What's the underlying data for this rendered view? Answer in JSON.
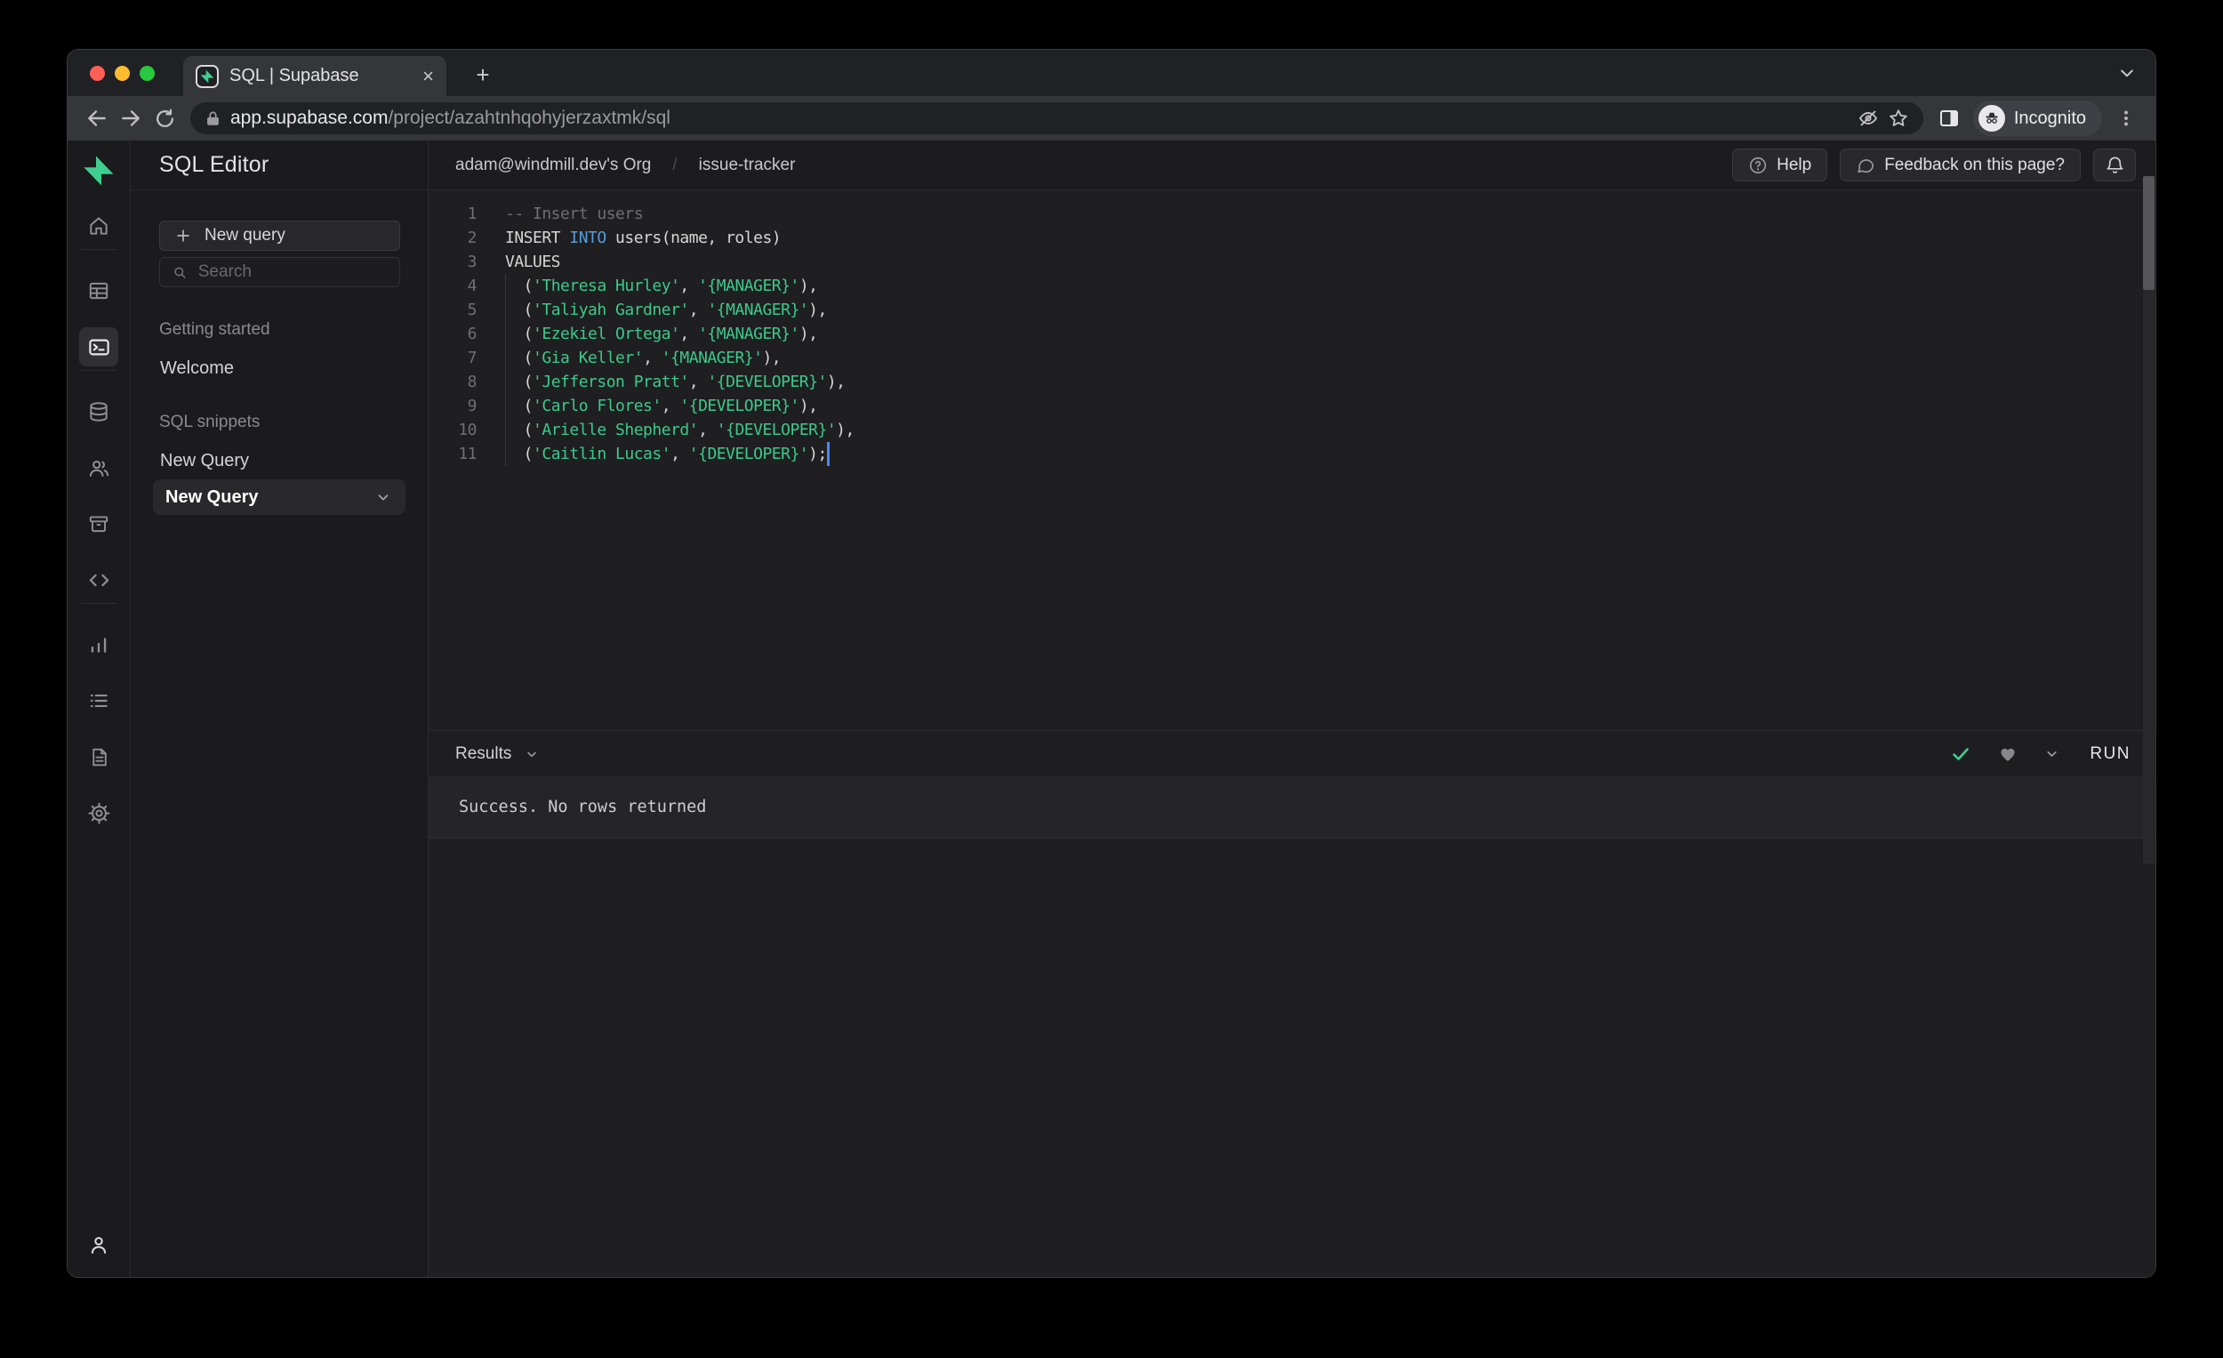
{
  "browser": {
    "tab_title": "SQL | Supabase",
    "new_tab_glyph": "+",
    "close_glyph": "×",
    "url_host": "app.supabase.com",
    "url_path": "/project/azahtnhqohyjerzaxtmk/sql",
    "incognito_label": "Incognito"
  },
  "sidebar": {
    "title": "SQL Editor",
    "new_query_button": "New query",
    "search_placeholder": "Search",
    "sections": [
      {
        "heading": "Getting started",
        "items": [
          "Welcome"
        ]
      },
      {
        "heading": "SQL snippets",
        "items": [
          "New Query"
        ]
      }
    ],
    "selected_snippet": "New Query"
  },
  "header": {
    "breadcrumb_org": "adam@windmill.dev's Org",
    "breadcrumb_sep": "/",
    "breadcrumb_project": "issue-tracker",
    "help_label": "Help",
    "feedback_label": "Feedback on this page?"
  },
  "editor": {
    "lines": [
      {
        "num": "1",
        "segments": [
          {
            "text": "-- Insert users",
            "style": "comment"
          }
        ]
      },
      {
        "num": "2",
        "segments": [
          {
            "text": "INSERT ",
            "style": "plain"
          },
          {
            "text": "INTO",
            "style": "keyword"
          },
          {
            "text": " users(name, roles)",
            "style": "plain"
          }
        ]
      },
      {
        "num": "3",
        "segments": [
          {
            "text": "VALUES",
            "style": "plain"
          }
        ]
      },
      {
        "num": "4",
        "segments": [
          {
            "text": "  (",
            "style": "plain"
          },
          {
            "text": "'Theresa Hurley'",
            "style": "string"
          },
          {
            "text": ", ",
            "style": "plain"
          },
          {
            "text": "'{MANAGER}'",
            "style": "string"
          },
          {
            "text": "),",
            "style": "plain"
          }
        ]
      },
      {
        "num": "5",
        "segments": [
          {
            "text": "  (",
            "style": "plain"
          },
          {
            "text": "'Taliyah Gardner'",
            "style": "string"
          },
          {
            "text": ", ",
            "style": "plain"
          },
          {
            "text": "'{MANAGER}'",
            "style": "string"
          },
          {
            "text": "),",
            "style": "plain"
          }
        ]
      },
      {
        "num": "6",
        "segments": [
          {
            "text": "  (",
            "style": "plain"
          },
          {
            "text": "'Ezekiel Ortega'",
            "style": "string"
          },
          {
            "text": ", ",
            "style": "plain"
          },
          {
            "text": "'{MANAGER}'",
            "style": "string"
          },
          {
            "text": "),",
            "style": "plain"
          }
        ]
      },
      {
        "num": "7",
        "segments": [
          {
            "text": "  (",
            "style": "plain"
          },
          {
            "text": "'Gia Keller'",
            "style": "string"
          },
          {
            "text": ", ",
            "style": "plain"
          },
          {
            "text": "'{MANAGER}'",
            "style": "string"
          },
          {
            "text": "),",
            "style": "plain"
          }
        ]
      },
      {
        "num": "8",
        "segments": [
          {
            "text": "  (",
            "style": "plain"
          },
          {
            "text": "'Jefferson Pratt'",
            "style": "string"
          },
          {
            "text": ", ",
            "style": "plain"
          },
          {
            "text": "'{DEVELOPER}'",
            "style": "string"
          },
          {
            "text": "),",
            "style": "plain"
          }
        ]
      },
      {
        "num": "9",
        "segments": [
          {
            "text": "  (",
            "style": "plain"
          },
          {
            "text": "'Carlo Flores'",
            "style": "string"
          },
          {
            "text": ", ",
            "style": "plain"
          },
          {
            "text": "'{DEVELOPER}'",
            "style": "string"
          },
          {
            "text": "),",
            "style": "plain"
          }
        ]
      },
      {
        "num": "10",
        "segments": [
          {
            "text": "  (",
            "style": "plain"
          },
          {
            "text": "'Arielle Shepherd'",
            "style": "string"
          },
          {
            "text": ", ",
            "style": "plain"
          },
          {
            "text": "'{DEVELOPER}'",
            "style": "string"
          },
          {
            "text": "),",
            "style": "plain"
          }
        ]
      },
      {
        "num": "11",
        "segments": [
          {
            "text": "  (",
            "style": "plain"
          },
          {
            "text": "'Caitlin Lucas'",
            "style": "string"
          },
          {
            "text": ", ",
            "style": "plain"
          },
          {
            "text": "'{DEVELOPER}'",
            "style": "string"
          },
          {
            "text": ");",
            "style": "plain"
          }
        ]
      }
    ]
  },
  "results": {
    "label": "Results",
    "run_label": "RUN",
    "message": "Success. No rows returned"
  },
  "icons": {
    "rail": [
      "home-icon",
      "table-editor-icon",
      "sql-editor-icon",
      "database-icon",
      "auth-users-icon",
      "storage-icon",
      "edge-functions-icon",
      "reports-icon",
      "logs-icon",
      "api-docs-icon",
      "settings-gear-icon",
      "account-icon"
    ],
    "other": [
      "supabase-logo",
      "lock-icon",
      "eye-off-icon",
      "star-icon",
      "side-panel-icon",
      "incognito-icon",
      "kebab-menu-icon",
      "help-circle-icon",
      "chat-bubble-icon",
      "bell-icon",
      "search-icon",
      "check-icon",
      "heart-icon",
      "chevron-down-icon"
    ]
  },
  "colors": {
    "accent_green": "#3ecf8e",
    "string_green": "#3dc98b",
    "keyword_blue": "#569cd6",
    "cursor_blue": "#5086f2",
    "traffic_red": "#ff5f57",
    "traffic_yellow": "#febc2e",
    "traffic_green": "#28c840"
  }
}
